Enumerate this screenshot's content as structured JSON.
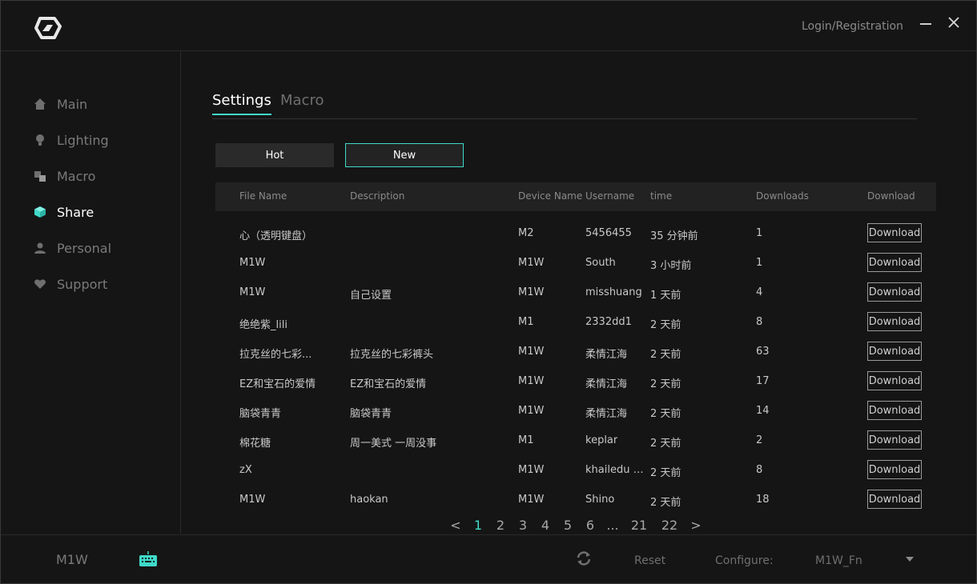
{
  "header": {
    "login_label": "Login/Registration",
    "logo_icon": "brand-logo-icon",
    "minimize_icon": "minimize-icon",
    "close_icon": "close-icon"
  },
  "sidebar": {
    "items": [
      {
        "label": "Main",
        "icon": "home-icon",
        "active": false
      },
      {
        "label": "Lighting",
        "icon": "bulb-icon",
        "active": false
      },
      {
        "label": "Macro",
        "icon": "macro-icon",
        "active": false
      },
      {
        "label": "Share",
        "icon": "cube-icon",
        "active": true
      },
      {
        "label": "Personal",
        "icon": "user-icon",
        "active": false
      },
      {
        "label": "Support",
        "icon": "heart-icon",
        "active": false
      }
    ]
  },
  "tabs": [
    {
      "label": "Settings",
      "active": true
    },
    {
      "label": "Macro",
      "active": false
    }
  ],
  "filters": {
    "hot_label": "Hot",
    "new_label": "New",
    "selected": "New"
  },
  "table": {
    "columns": [
      "File Name",
      "Description",
      "Device Name",
      "Username",
      "time",
      "Downloads",
      "Download"
    ],
    "rows": [
      {
        "file": "心（透明键盘）",
        "desc": "",
        "device": "M2",
        "user": "5456455",
        "time": "35 分钟前",
        "downloads": "1",
        "action": "Download"
      },
      {
        "file": "M1W",
        "desc": "",
        "device": "M1W",
        "user": "South",
        "time": "3 小时前",
        "downloads": "1",
        "action": "Download"
      },
      {
        "file": "M1W",
        "desc": "自己设置",
        "device": "M1W",
        "user": "misshuang",
        "time": "1 天前",
        "downloads": "4",
        "action": "Download"
      },
      {
        "file": "绝绝紫_lili",
        "desc": "",
        "device": "M1",
        "user": "2332dd1",
        "time": "2 天前",
        "downloads": "8",
        "action": "Download"
      },
      {
        "file": "拉克丝的七彩...",
        "desc": "拉克丝的七彩裤头",
        "device": "M1W",
        "user": "柔情江海",
        "time": "2 天前",
        "downloads": "63",
        "action": "Download"
      },
      {
        "file": "EZ和宝石的爱情",
        "desc": "EZ和宝石的爱情",
        "device": "M1W",
        "user": "柔情江海",
        "time": "2 天前",
        "downloads": "17",
        "action": "Download"
      },
      {
        "file": "脑袋青青",
        "desc": "脑袋青青",
        "device": "M1W",
        "user": "柔情江海",
        "time": "2 天前",
        "downloads": "14",
        "action": "Download"
      },
      {
        "file": "棉花糖",
        "desc": "周一美式 一周没事",
        "device": "M1",
        "user": "keplar",
        "time": "2 天前",
        "downloads": "2",
        "action": "Download"
      },
      {
        "file": "zX",
        "desc": "",
        "device": "M1W",
        "user": "khailedu y...",
        "time": "2 天前",
        "downloads": "8",
        "action": "Download"
      },
      {
        "file": "M1W",
        "desc": "haokan",
        "device": "M1W",
        "user": "Shino",
        "time": "2 天前",
        "downloads": "18",
        "action": "Download"
      }
    ]
  },
  "pagination": {
    "prev": "<",
    "pages": [
      "1",
      "2",
      "3",
      "4",
      "5",
      "6",
      "...",
      "21",
      "22"
    ],
    "current": "1",
    "next": ">"
  },
  "footer": {
    "device": "M1W",
    "keyboard_icon": "keyboard-icon",
    "refresh_icon": "refresh-icon",
    "reset_label": "Reset",
    "configure_label": "Configure:",
    "config_value": "M1W_Fn",
    "dropdown_icon": "chevron-down-icon"
  },
  "colors": {
    "accent": "#3fd9c9",
    "background": "#151515",
    "header_row": "#222222"
  }
}
